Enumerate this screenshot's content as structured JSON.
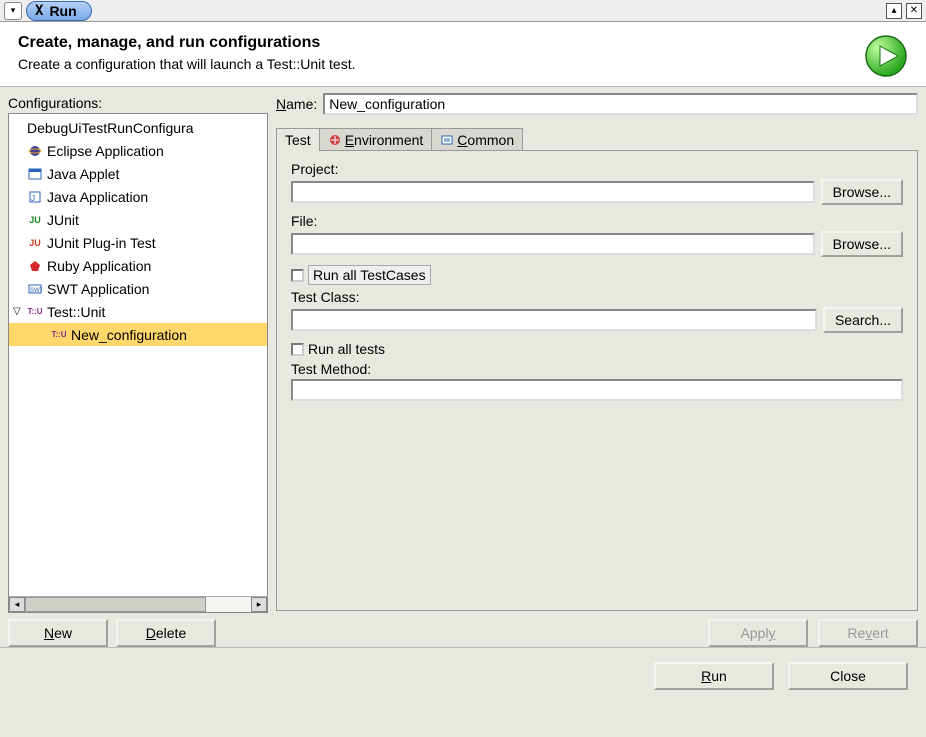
{
  "window": {
    "title": "Run"
  },
  "header": {
    "title": "Create, manage, and run configurations",
    "subtitle": "Create a configuration that will launch a Test::Unit test."
  },
  "config_label": "Configurations:",
  "tree": {
    "items": [
      {
        "label": "DebugUiTestRunConfigura",
        "icon": "folder"
      },
      {
        "label": "Eclipse Application",
        "icon": "eclipse"
      },
      {
        "label": "Java Applet",
        "icon": "applet"
      },
      {
        "label": "Java Application",
        "icon": "java"
      },
      {
        "label": "JUnit",
        "icon": "junit"
      },
      {
        "label": "JUnit Plug-in Test",
        "icon": "junit-plugin"
      },
      {
        "label": "Ruby Application",
        "icon": "ruby"
      },
      {
        "label": "SWT Application",
        "icon": "swt"
      },
      {
        "label": "Test::Unit",
        "icon": "testunit",
        "expanded": true
      },
      {
        "label": "New_configuration",
        "icon": "testunit",
        "child": true,
        "selected": true
      }
    ]
  },
  "left_buttons": {
    "new": "New",
    "delete": "Delete"
  },
  "name": {
    "label": "Name:",
    "value": "New_configuration"
  },
  "tabs": {
    "items": [
      {
        "label": "Test",
        "active": true
      },
      {
        "label": "Environment"
      },
      {
        "label": "Common"
      }
    ]
  },
  "form": {
    "project_label": "Project:",
    "project_value": "",
    "browse1": "Browse...",
    "file_label": "File:",
    "file_value": "",
    "browse2": "Browse...",
    "run_all_testcases": "Run all TestCases",
    "test_class_label": "Test Class:",
    "test_class_value": "",
    "search": "Search...",
    "run_all_tests": "Run all tests",
    "test_method_label": "Test Method:",
    "test_method_value": ""
  },
  "right_buttons": {
    "apply": "Apply",
    "revert": "Revert"
  },
  "footer": {
    "run": "Run",
    "close": "Close"
  }
}
